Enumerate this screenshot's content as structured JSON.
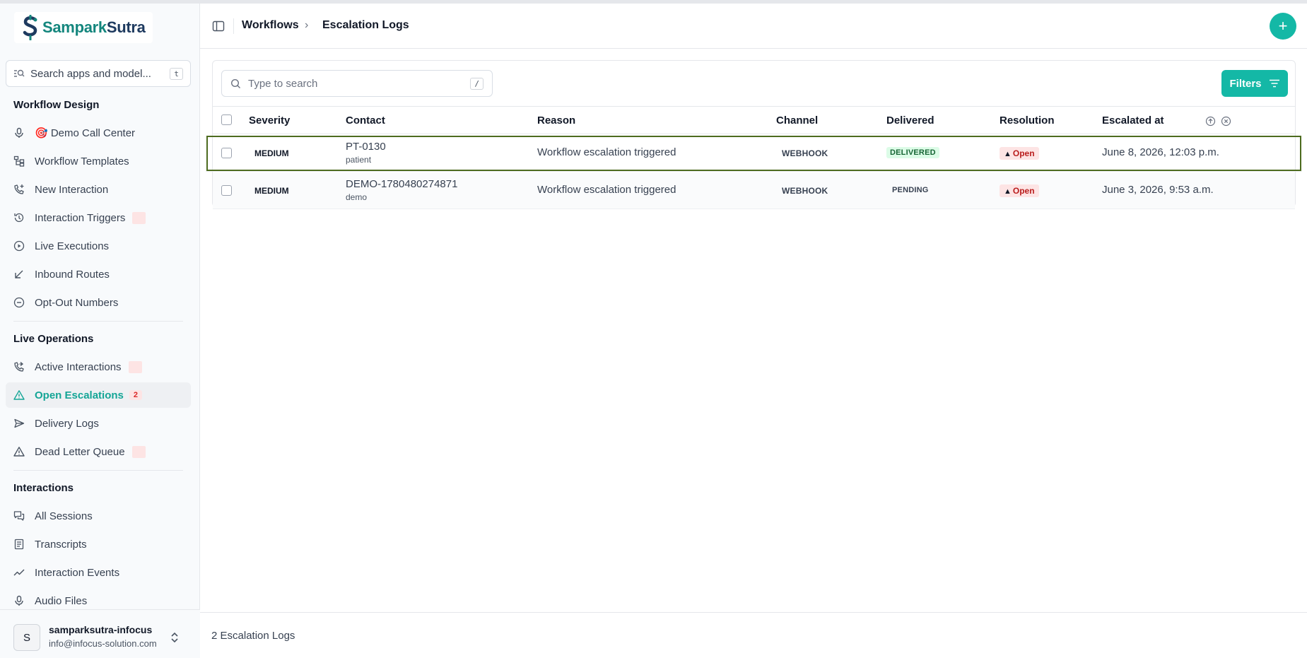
{
  "app": {
    "brand_part1": "Sampark",
    "brand_part2": "Sutra"
  },
  "sidebar": {
    "search": {
      "placeholder": "Search apps and model...",
      "shortcut": "t"
    },
    "sections": [
      {
        "title": "Workflow Design",
        "items": [
          {
            "label": "🎯 Demo Call Center",
            "icon": "microphone-icon"
          },
          {
            "label": "Workflow Templates",
            "icon": "workflow-icon"
          },
          {
            "label": "New Interaction",
            "icon": "phone-plus-icon"
          },
          {
            "label": "Interaction Triggers",
            "icon": "history-icon"
          },
          {
            "label": "Live Executions",
            "icon": "play-circle-icon"
          },
          {
            "label": "Inbound Routes",
            "icon": "arrow-down-left-icon"
          },
          {
            "label": "Opt-Out Numbers",
            "icon": "minus-circle-icon"
          }
        ]
      },
      {
        "title": "Live Operations",
        "items": [
          {
            "label": "Active Interactions",
            "icon": "phone-forward-icon"
          },
          {
            "label": "Open Escalations",
            "icon": "warning-icon",
            "badge": "2"
          },
          {
            "label": "Delivery Logs",
            "icon": "send-icon"
          },
          {
            "label": "Dead Letter Queue",
            "icon": "warning-icon"
          }
        ]
      },
      {
        "title": "Interactions",
        "items": [
          {
            "label": "All Sessions",
            "icon": "chat-icon"
          },
          {
            "label": "Transcripts",
            "icon": "document-icon"
          },
          {
            "label": "Interaction Events",
            "icon": "trend-icon"
          },
          {
            "label": "Audio Files",
            "icon": "microphone-icon"
          }
        ]
      }
    ],
    "user": {
      "initial": "S",
      "name": "samparksutra-infocus",
      "email": "info@infocus-solution.com"
    }
  },
  "header": {
    "breadcrumb_parent": "Workflows",
    "breadcrumb_current": "Escalation Logs",
    "add_label": "+"
  },
  "table": {
    "search_placeholder": "Type to search",
    "search_shortcut": "/",
    "filters_label": "Filters",
    "columns": [
      "Severity",
      "Contact",
      "Reason",
      "Channel",
      "Delivered",
      "Resolution",
      "Escalated at"
    ],
    "rows": [
      {
        "severity": "MEDIUM",
        "contact_id": "PT-0130",
        "contact_type": "patient",
        "reason": "Workflow escalation triggered",
        "channel": "WEBHOOK",
        "delivered": "DELIVERED",
        "resolution": "Open",
        "escalated_at": "June 8, 2026, 12:03 p.m."
      },
      {
        "severity": "MEDIUM",
        "contact_id": "DEMO-1780480274871",
        "contact_type": "demo",
        "reason": "Workflow escalation triggered",
        "channel": "WEBHOOK",
        "delivered": "PENDING",
        "resolution": "Open",
        "escalated_at": "June 3, 2026, 9:53 a.m."
      }
    ]
  },
  "footer": {
    "count_label": "2 Escalation Logs"
  },
  "colors": {
    "accent": "#14b8a6",
    "brand_teal": "#14867d",
    "brand_navy": "#1e3a5f",
    "danger_bg": "#fde4e4",
    "success_bg": "#dcfce7"
  }
}
